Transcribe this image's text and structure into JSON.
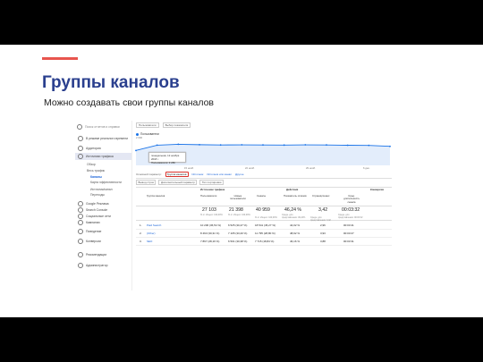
{
  "slide": {
    "title": "Группы каналов",
    "subtitle": "Можно создавать свои группы каналов",
    "accent_color": "#e8554e",
    "title_color": "#2a3f8e"
  },
  "sidebar": {
    "search_placeholder": "Поиск отчетов и справки",
    "items": [
      {
        "label": "В режиме реального времени",
        "icon": "clock-icon"
      },
      {
        "label": "Аудитория",
        "icon": "person-icon"
      },
      {
        "label": "Источники трафика",
        "icon": "acquisition-icon"
      },
      {
        "label": "Google Реклама",
        "icon": "triangle-icon"
      },
      {
        "label": "Search Console",
        "icon": "triangle-icon"
      },
      {
        "label": "Социальные сети",
        "icon": "triangle-icon"
      },
      {
        "label": "Кампании",
        "icon": "triangle-icon"
      },
      {
        "label": "Поведение",
        "icon": "behavior-icon"
      },
      {
        "label": "Конверсии",
        "icon": "flag-icon"
      },
      {
        "label": "Рекомендации",
        "icon": "bulb-icon"
      },
      {
        "label": "Администратор",
        "icon": "gear-icon"
      }
    ],
    "subitems": [
      {
        "label": "Обзор"
      },
      {
        "label": "Весь трафик"
      },
      {
        "label": "Каналы"
      },
      {
        "label": "Карта эффективности"
      },
      {
        "label": "Источник/канал"
      },
      {
        "label": "Переходы"
      }
    ]
  },
  "chart": {
    "buttons": [
      "Пользователи",
      "Выбор показателя"
    ],
    "legend": "Пользователи",
    "ymax_label": "2 000",
    "tooltip_date": "понедельник, 12 ноября 2018 г.",
    "tooltip_value": "Пользователи: 3 286",
    "xticks": [
      "15 нояб.",
      "22 нояб.",
      "29 нояб.",
      "6 дек."
    ],
    "line_color": "#1a73e8"
  },
  "chart_data": {
    "type": "area",
    "title": "",
    "series": [
      {
        "name": "Пользователи",
        "values": [
          2900,
          3286,
          3350,
          3320,
          3300,
          3310,
          3300,
          3290,
          3310,
          3300,
          3280,
          3270,
          3200
        ]
      }
    ],
    "x": [
      "11 нояб.",
      "15 нояб.",
      "18 нояб.",
      "22 нояб.",
      "25 нояб.",
      "29 нояб.",
      "2 дек.",
      "6 дек.",
      "9 дек.",
      "12 дек.",
      "14 дек.",
      "16 дек.",
      "18 дек."
    ],
    "ylim": [
      0,
      4000
    ],
    "legend": "top-left",
    "grid": false
  },
  "tabs": {
    "label": "Основной параметр:",
    "items": [
      "Группа каналов",
      "Источник",
      "Источник или канал",
      "Другое"
    ],
    "selected": "Группа каналов"
  },
  "toolbar": [
    "Вывод строк",
    "Дополнительный параметр",
    "Тип сортировки"
  ],
  "table": {
    "headers": [
      "Группа каналов",
      "Пользователи",
      "Новые пользователи",
      "Сеансы",
      "Показатель отказов",
      "Страниц/сеанс",
      "Сред. длительность сеанса"
    ],
    "group_headers": [
      "Источники трафика",
      "Действия",
      "Конверсии"
    ],
    "totals": {
      "values": [
        "27 103",
        "21 398",
        "40 959",
        "46,24 %",
        "3,42",
        "00:03:32"
      ],
      "subs": [
        "% от общего: 100,00%",
        "% от общего: 100,09%",
        "% от общего: 100,00%",
        "Средн. для представления: 46,24%",
        "Средн. для представления: 3,42",
        "Средн. для представления: 00:03:32"
      ]
    },
    "rows": [
      {
        "num": "1.",
        "name": "Paid Search",
        "values": [
          "10 206 (36,54 %)",
          "6 525 (30,47 %)",
          "18 541 (45,27 %)",
          "44,02 %",
          "2,96",
          "00:03:41"
        ]
      },
      {
        "num": "2.",
        "name": "(Other)",
        "values": [
          "8 463 (30,31 %)",
          "7 105 (33,20 %)",
          "11 795 (28,80 %)",
          "48,92 %",
          "3,93",
          "00:03:27"
        ]
      },
      {
        "num": "3.",
        "name": "SEO",
        "values": [
          "7 867 (28,16 %)",
          "6 501 (30,38 %)",
          "7 715 (18,84 %)",
          "46,16 %",
          "3,88",
          "00:03:31"
        ]
      }
    ]
  }
}
